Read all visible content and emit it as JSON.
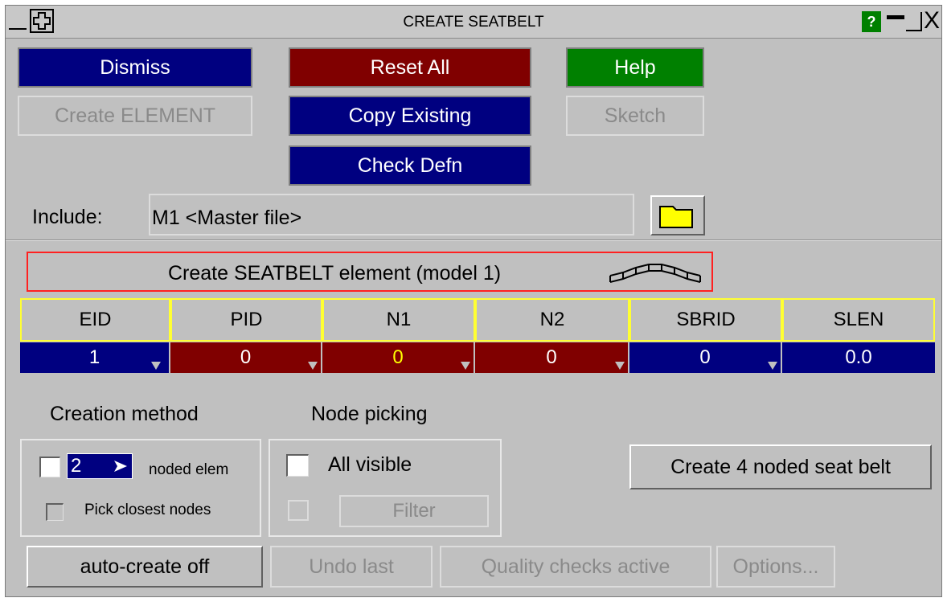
{
  "window": {
    "title": "CREATE SEATBELT",
    "help_glyph": "?",
    "minimize_glyph": "▬",
    "close_glyph": "X"
  },
  "toolbar": {
    "dismiss": "Dismiss",
    "reset_all": "Reset All",
    "help": "Help",
    "create_element": "Create ELEMENT",
    "copy_existing": "Copy Existing",
    "sketch": "Sketch",
    "check_defn": "Check Defn"
  },
  "include": {
    "label": "Include:",
    "value": "M1  <Master file>"
  },
  "create_banner": "Create SEATBELT element (model 1)",
  "table": {
    "headers": [
      "EID",
      "PID",
      "N1",
      "N2",
      "SBRID",
      "SLEN"
    ],
    "values": [
      "1",
      "0",
      "0",
      "0",
      "0",
      "0.0"
    ]
  },
  "creation": {
    "title": "Creation method",
    "node_count": "2",
    "noded_elem_label": "noded elem",
    "pick_closest_label": "Pick closest nodes"
  },
  "node_picking": {
    "title": "Node picking",
    "all_visible_label": "All visible",
    "filter_label": "Filter"
  },
  "create_4_noded": "Create 4 noded seat belt",
  "bottom": {
    "auto_create": "auto-create off",
    "undo_last": "Undo last",
    "quality_checks": "Quality checks active",
    "options": "Options..."
  },
  "colors": {
    "blue": "#000080",
    "red": "#800000",
    "green": "#008000",
    "panel": "#c0c0c0",
    "header_border": "#ffff33",
    "n1_value": "#ffff00"
  }
}
